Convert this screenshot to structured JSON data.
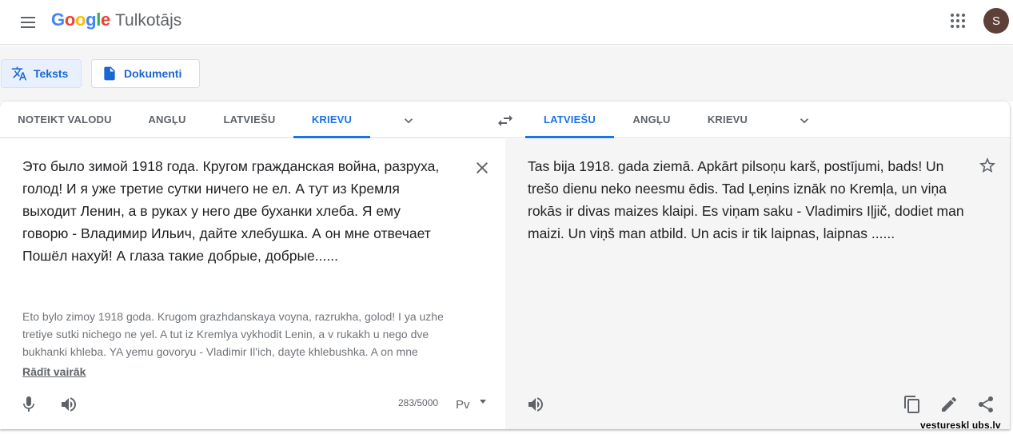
{
  "header": {
    "logo_letters": [
      {
        "ch": "G",
        "color": "#4285F4"
      },
      {
        "ch": "o",
        "color": "#EA4335"
      },
      {
        "ch": "o",
        "color": "#FBBC05"
      },
      {
        "ch": "g",
        "color": "#4285F4"
      },
      {
        "ch": "l",
        "color": "#34A853"
      },
      {
        "ch": "e",
        "color": "#EA4335"
      }
    ],
    "product": "Tulkotājs",
    "avatar_initial": "S"
  },
  "modes": {
    "text_label": "Teksts",
    "documents_label": "Dokumenti"
  },
  "source_langs": {
    "tabs": [
      "NOTEIKT VALODU",
      "ANGĻU",
      "LATVIEŠU",
      "KRIEVU"
    ],
    "active_index": 3
  },
  "target_langs": {
    "tabs": [
      "LATVIEŠU",
      "ANGĻU",
      "KRIEVU"
    ],
    "active_index": 0
  },
  "source": {
    "text": "Это было зимой 1918 года. Кругом гражданская война, разруха,\nголод! И я уже третие сутки ничего не ел. А тут из Кремля\nвыходит Ленин, а в руках у него две буханки хлеба. Я ему\nговорю - Владимир Ильич, дайте хлебушка. А он мне отвечает\nПошёл нахуй! А глаза такие добрые, добрые......",
    "transliteration": "Eto bylo zimoy 1918 goda. Krugom grazhdanskaya voyna, razrukha, golod! I ya uzhe tretiye sutki nichego ne yel. A tut iz Kremlya vykhodit Lenin, a v rukakh u nego dve bukhanki khleba. YA yemu govoryu - Vladimir Il'ich, dayte khlebushka. A on mne",
    "show_more": "Rādīt vairāk",
    "char_count": "283/5000",
    "keyboard_glyph": "Рv"
  },
  "target": {
    "text": "Tas bija 1918. gada ziemā. Apkārt pilsoņu karš, postījumi, bads! Un trešo dienu neko neesmu ēdis. Tad Ļeņins iznāk no Kremļa, un viņa rokās ir divas maizes klaipi. Es viņam saku - Vladimirs Iļjič, dodiet man maizi. Un viņš man atbild. Un acis ir tik laipnas, laipnas ......"
  },
  "watermark": "vestureskl ubs.lv",
  "colors": {
    "accent": "#1a73e8",
    "avatar_bg": "#5d4037"
  }
}
